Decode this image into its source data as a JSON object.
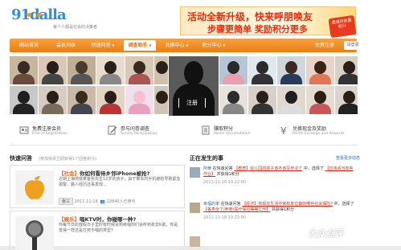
{
  "header": {
    "logo_text": "91dalla",
    "slogan": "每个人都是社会的决策者",
    "banner_line1": "活动全新升级，快来呼朋唤友",
    "banner_line2": "步骤更简单 奖励积分更多",
    "banner_badge": "邀请好友赢积分"
  },
  "nav": {
    "items": [
      {
        "label": "网站首页"
      },
      {
        "label": "会员列表"
      },
      {
        "label": "快速问答"
      },
      {
        "label": "调查助手"
      },
      {
        "label": "兑换中心"
      },
      {
        "label": "积分中心"
      }
    ],
    "login_label": "免费注册",
    "search_label": "请登录"
  },
  "hero": {
    "register_label": "注册"
  },
  "features": [
    {
      "title": "免费注册会员",
      "sub": "Free of Registration"
    },
    {
      "title": "参与问卷调查",
      "sub": "Survey Participation"
    },
    {
      "title": "赚取积分",
      "sub": "Points Accumulation"
    },
    {
      "title": "兑换现金及奖励",
      "sub": "Points Excange and Rewards"
    }
  ],
  "quick_qa": {
    "title": "快速问答",
    "subtitle": "(参加快票立即获得1个回答积分)",
    "cards": [
      {
        "tag": "【社会】",
        "question": "你如何看待乡邻iPhone被抢?",
        "desc": "近期上海地铁乘客张先生12岁的孩子，由于乘车时手机被抢导致紧急报警，路人经历还事发现...",
        "user": "张三",
        "time": "2011-11-18",
        "count": "22840人已参与"
      },
      {
        "tag": "【娱乐】",
        "question": "唱KTV时，你碰哪一种?",
        "desc": "你每节日的放假日子里时有时候会到练唱你们会听到有去K歌，你是觉得一样还是打死不唱的类型?",
        "user": "",
        "time": "",
        "count": ""
      }
    ]
  },
  "activity": {
    "title": "正在发生的事",
    "more_label": "查看更多动态",
    "items": [
      {
        "user": "阿黄",
        "action": "在快速问答",
        "topic": "【教育】幼儿园的孩子该不该写作业了",
        "result": "中，选择了",
        "choice": "【应该适当有些作业】",
        "tail": "并获得1积分",
        "time": "2011-11-18 10:22:00"
      },
      {
        "user": "幸福的家",
        "action": "在快速问答",
        "topic": "【经济】你现在生活中常有单位做的哪些社会保险?",
        "result": "中，选择了",
        "choice": "【各类全了/养老/医疗保险等等工作】",
        "tail": "并获得1积分",
        "time": "2011-11-18 10:22:00"
      },
      {
        "user": "",
        "action": "",
        "topic": "",
        "result": "",
        "choice": "",
        "tail": "",
        "time": ""
      }
    ]
  },
  "watermark": "大众点评"
}
